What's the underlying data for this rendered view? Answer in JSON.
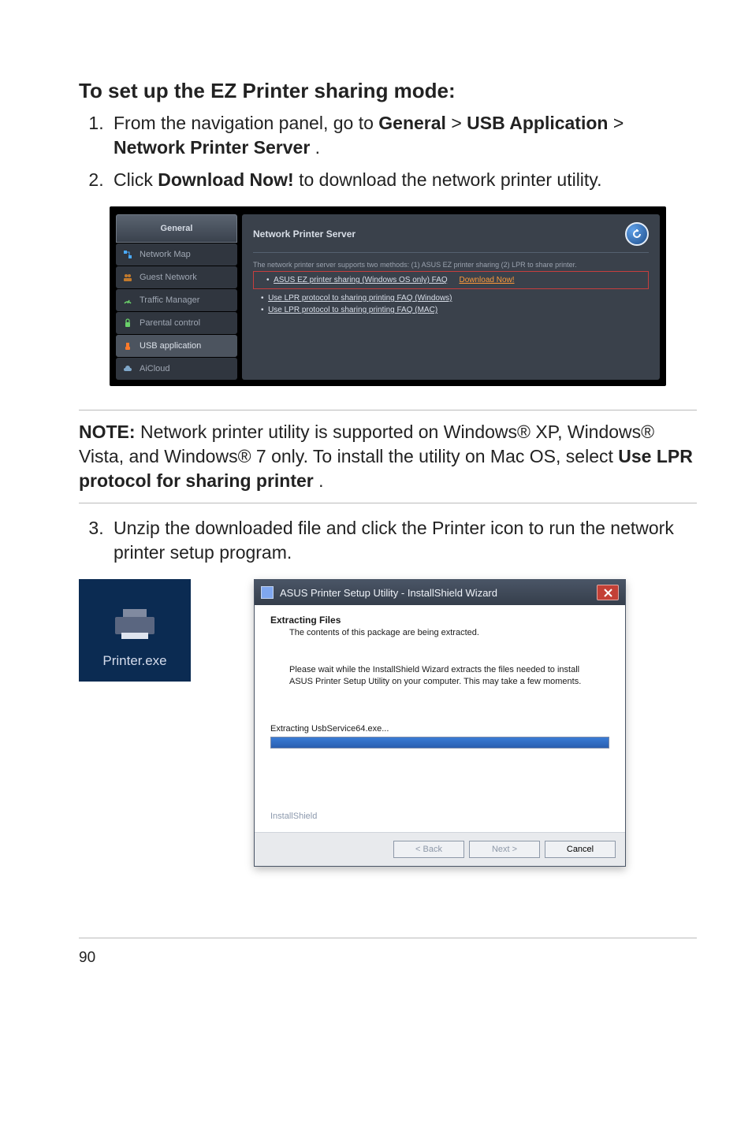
{
  "heading": "To set up the EZ Printer sharing mode:",
  "steps1": {
    "s1_pre": "From the navigation panel, go to ",
    "s1_b1": "General",
    "s1_gt1": " > ",
    "s1_b2": "USB Application",
    "s1_gt2": " > ",
    "s1_b3": "Network Printer Server",
    "s1_post": ".",
    "s2_pre": "Click ",
    "s2_b1": "Download Now!",
    "s2_post": " to download the network printer utility."
  },
  "router": {
    "general_label": "General",
    "side_netmap": "Network Map",
    "side_guest": "Guest Network",
    "side_traffic": "Traffic Manager",
    "side_parental": "Parental control",
    "side_usb": "USB application",
    "side_aicloud": "AiCloud",
    "main_title": "Network Printer Server",
    "support_line": "The network printer server supports two methods: (1) ASUS EZ printer sharing (2) LPR to share printer.",
    "faq_windows_share": "ASUS EZ printer sharing (Windows OS only) FAQ",
    "download_now": "Download Now!",
    "faq_lpr_win": "Use LPR protocol to sharing printing FAQ (Windows)",
    "faq_lpr_mac": "Use LPR protocol to sharing printing FAQ (MAC)"
  },
  "note": {
    "label": "NOTE:",
    "body_pre": " Network printer utility is supported on Windows® XP, Windows® Vista, and Windows® 7 only. To install the utility on Mac OS, select ",
    "body_bold": "Use LPR protocol for sharing printer",
    "body_post": "."
  },
  "steps2": {
    "s3": "Unzip the downloaded file and click the Printer icon to run the network printer setup program."
  },
  "exe_label": "Printer.exe",
  "wizard": {
    "title": "ASUS Printer Setup Utility - InstallShield Wizard",
    "head": "Extracting Files",
    "sub": "The contents of this package are being extracted.",
    "body": "Please wait while the InstallShield Wizard extracts the files needed to install ASUS Printer Setup Utility on your computer.  This may take a few moments.",
    "extracting": "Extracting UsbService64.exe...",
    "ishield": "InstallShield",
    "btn_back": "< Back",
    "btn_next": "Next >",
    "btn_cancel": "Cancel"
  },
  "page_number": "90"
}
